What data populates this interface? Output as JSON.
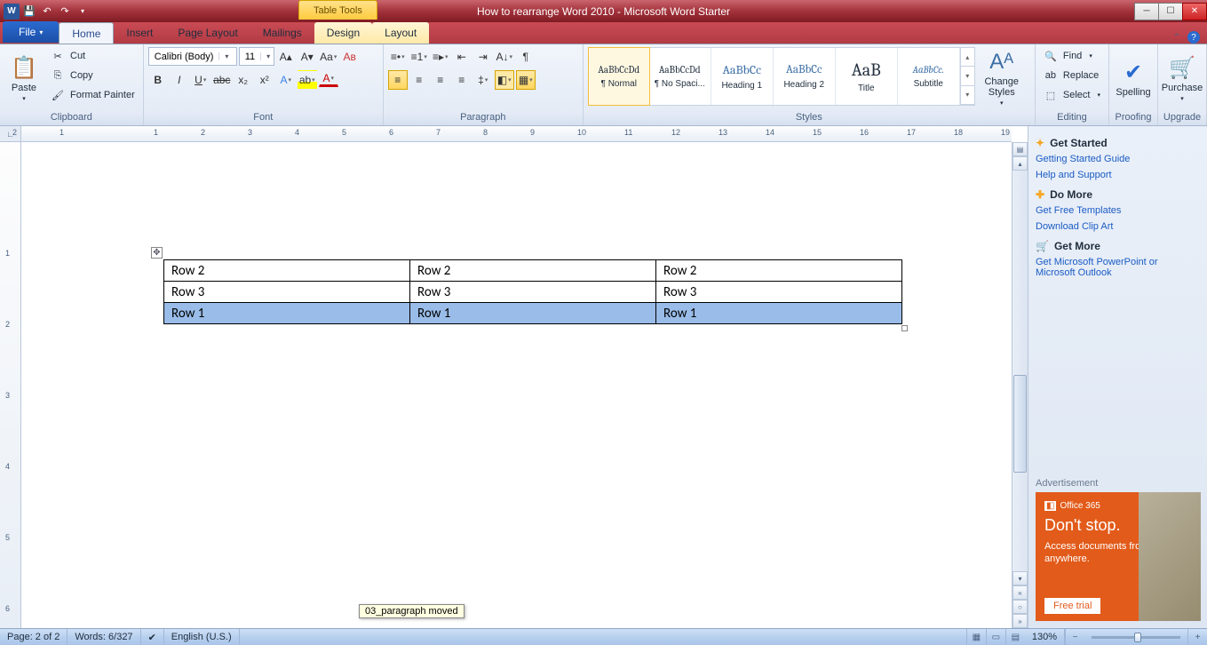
{
  "title": "How to rearrange Word 2010  -  Microsoft Word Starter",
  "context_tab": "Table Tools",
  "tabs": {
    "file": "File",
    "home": "Home",
    "insert": "Insert",
    "pagelayout": "Page Layout",
    "mailings": "Mailings",
    "design": "Design",
    "layout": "Layout"
  },
  "clipboard": {
    "paste": "Paste",
    "cut": "Cut",
    "copy": "Copy",
    "fmt": "Format Painter",
    "group": "Clipboard"
  },
  "font": {
    "name": "Calibri (Body)",
    "size": "11",
    "group": "Font"
  },
  "paragraph": {
    "group": "Paragraph"
  },
  "styles": {
    "group": "Styles",
    "change": "Change Styles",
    "items": [
      {
        "preview": "AaBbCcDd",
        "label": "¶ Normal"
      },
      {
        "preview": "AaBbCcDd",
        "label": "¶ No Spaci..."
      },
      {
        "preview": "AaBbCc",
        "label": "Heading 1"
      },
      {
        "preview": "AaBbCc",
        "label": "Heading 2"
      },
      {
        "preview": "AaB",
        "label": "Title"
      },
      {
        "preview": "AaBbCc.",
        "label": "Subtitle"
      }
    ]
  },
  "editing": {
    "find": "Find",
    "replace": "Replace",
    "select": "Select",
    "group": "Editing"
  },
  "proofing": {
    "spelling": "Spelling",
    "group": "Proofing"
  },
  "upgrade": {
    "purchase": "Purchase",
    "group": "Upgrade"
  },
  "sidepanel": {
    "get_started": "Get Started",
    "gsg": "Getting Started Guide",
    "help": "Help and Support",
    "do_more": "Do More",
    "templates": "Get Free Templates",
    "clipart": "Download Clip Art",
    "get_more": "Get More",
    "office": "Get Microsoft PowerPoint or Microsoft Outlook",
    "ad_label": "Advertisement",
    "ad_brand": "Office 365",
    "ad_head": "Don't stop.",
    "ad_body": "Access documents from nearly anywhere.",
    "ad_cta": "Free trial"
  },
  "table": {
    "rows": [
      {
        "c1": "Row 2",
        "c2": "Row 2",
        "c3": "Row 2",
        "sel": false
      },
      {
        "c1": "Row 3",
        "c2": "Row 3",
        "c3": "Row 3",
        "sel": false
      },
      {
        "c1": "Row 1",
        "c2": "Row 1",
        "c3": "Row 1",
        "sel": true
      }
    ]
  },
  "tooltip": "03_paragraph moved",
  "status": {
    "page": "Page: 2 of 2",
    "words": "Words: 6/327",
    "lang": "English (U.S.)",
    "zoom": "130%"
  },
  "ruler_numbers": [
    "2",
    "1",
    "",
    "1",
    "2",
    "3",
    "4",
    "5",
    "6",
    "7",
    "8",
    "9",
    "10",
    "11",
    "12",
    "13",
    "14",
    "15",
    "16",
    "17",
    "18",
    "19"
  ]
}
